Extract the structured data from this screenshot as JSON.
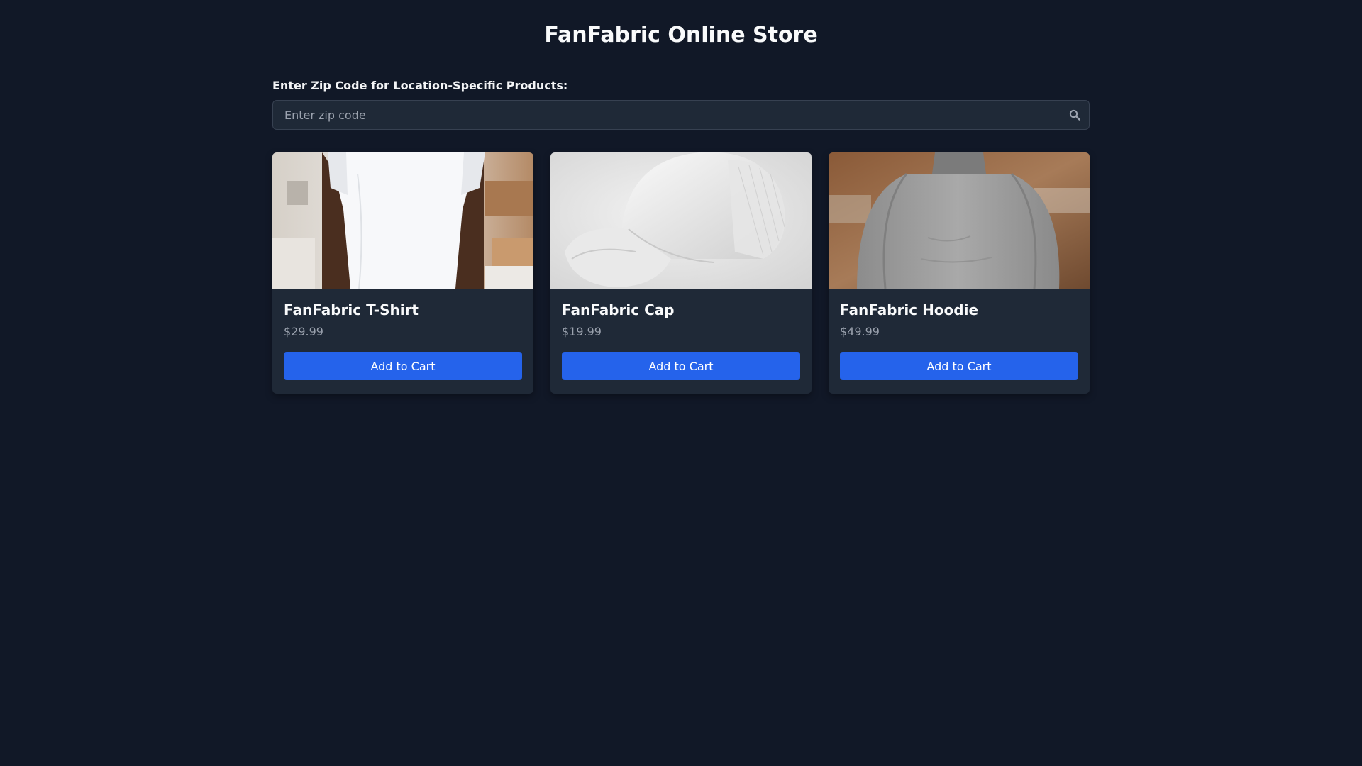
{
  "header": {
    "title": "FanFabric Online Store"
  },
  "zip": {
    "label": "Enter Zip Code for Location-Specific Products:",
    "placeholder": "Enter zip code",
    "value": "",
    "search_icon": "search-icon"
  },
  "products": [
    {
      "name": "FanFabric T-Shirt",
      "price": "$29.99",
      "button_label": "Add to Cart",
      "image": "white t-shirt photo"
    },
    {
      "name": "FanFabric Cap",
      "price": "$19.99",
      "button_label": "Add to Cart",
      "image": "white trucker cap photo"
    },
    {
      "name": "FanFabric Hoodie",
      "price": "$49.99",
      "button_label": "Add to Cart",
      "image": "grey hoodie photo"
    }
  ],
  "colors": {
    "background": "#111827",
    "card": "#1f2937",
    "accent": "#2563eb",
    "muted_text": "#9ca3af"
  }
}
